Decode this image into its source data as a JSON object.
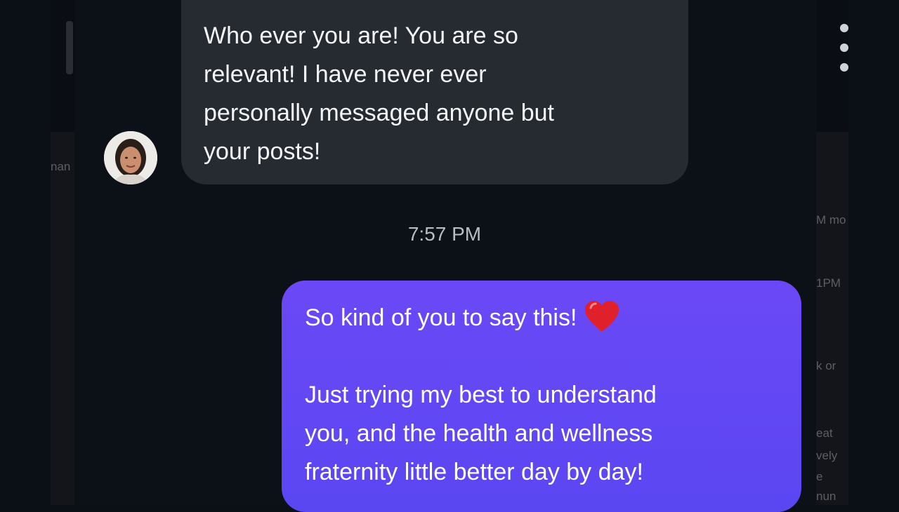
{
  "background": {
    "left_fragment": "nan",
    "right_fragments": [
      "M mo",
      "1PM",
      "k or",
      "eat",
      "vely",
      "e",
      "nun"
    ]
  },
  "incoming_message": {
    "lines": [
      "Who ever you are! You are so",
      "relevant! I have never ever",
      "personally messaged anyone but",
      "your posts!"
    ]
  },
  "timestamp": "7:57 PM",
  "outgoing_message": {
    "first_line": "So kind of you to say this!",
    "emoji": "red-heart-emoji",
    "paragraph_lines": [
      "Just trying my best to understand",
      "you, and the health and wellness",
      "fraternity little better day by day!"
    ]
  },
  "colors": {
    "incoming_bubble": "#262a31",
    "outgoing_bubble": "#6b48f6",
    "chat_background": "#0c1017",
    "heart": "#e0202a"
  }
}
